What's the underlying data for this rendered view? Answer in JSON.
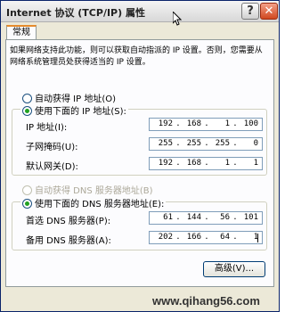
{
  "window": {
    "title": "Internet 协议 (TCP/IP) 属性",
    "help_label": "?",
    "close_label": "✕",
    "help_icon": "question-icon",
    "close_icon": "close-icon"
  },
  "tabs": [
    {
      "label": "常规"
    }
  ],
  "description": "如果网络支持此功能，则可以获取自动指派的 IP 设置。否则，您需要从网络系统管理员处获得适当的 IP 设置。",
  "ip_mode": {
    "auto_label": "自动获得 IP 地址(O)",
    "manual_label": "使用下面的 IP 地址(S):",
    "selected": "manual"
  },
  "ip_fields": [
    {
      "label": "IP 地址(I):",
      "octets": [
        "192",
        "168",
        "1",
        "100"
      ]
    },
    {
      "label": "子网掩码(U):",
      "octets": [
        "255",
        "255",
        "255",
        "0"
      ]
    },
    {
      "label": "默认网关(D):",
      "octets": [
        "192",
        "168",
        "1",
        "1"
      ]
    }
  ],
  "dns_mode": {
    "auto_label": "自动获得 DNS 服务器地址(B)",
    "manual_label": "使用下面的 DNS 服务器地址(E):",
    "selected": "manual",
    "auto_disabled": true
  },
  "dns_fields": [
    {
      "label": "首选 DNS 服务器(P):",
      "octets": [
        "61",
        "144",
        "56",
        "101"
      ]
    },
    {
      "label": "备用 DNS 服务器(A):",
      "octets": [
        "202",
        "166",
        "64",
        "1"
      ]
    }
  ],
  "advanced_label": "高级(V)...",
  "watermark": "www.qihang56.com",
  "colors": {
    "tab_accent": "#e68b2c",
    "radio_selected": "#21a121",
    "input_border": "#7f9db9"
  }
}
